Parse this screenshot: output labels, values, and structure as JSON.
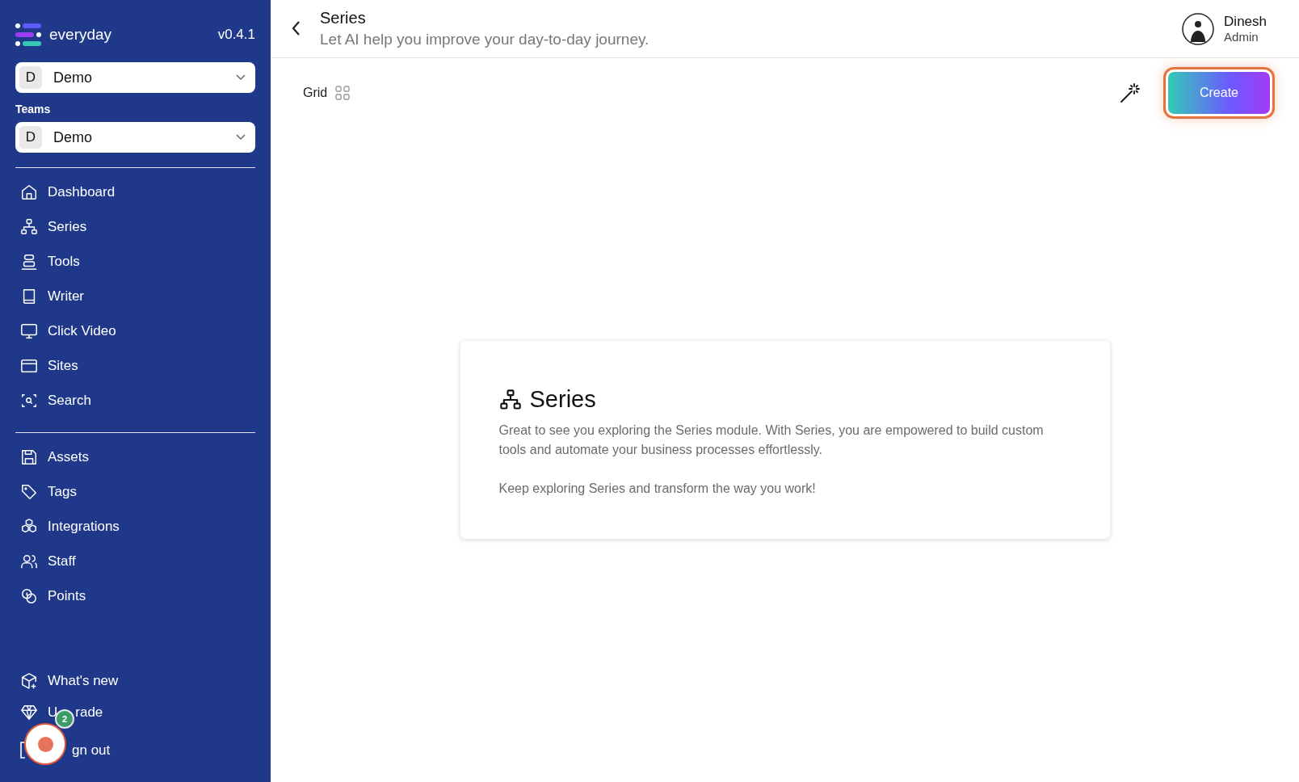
{
  "brand": {
    "name": "everyday",
    "version": "v0.4.1"
  },
  "workspace_select": {
    "initial": "D",
    "value": "Demo"
  },
  "teams": {
    "label": "Teams",
    "select": {
      "initial": "D",
      "value": "Demo"
    }
  },
  "nav_main": [
    {
      "label": "Dashboard",
      "selected": false
    },
    {
      "label": "Series",
      "selected": false
    },
    {
      "label": "Tools",
      "selected": false
    },
    {
      "label": "Writer",
      "selected": false
    },
    {
      "label": "Click Video",
      "selected": false
    },
    {
      "label": "Sites",
      "selected": false
    },
    {
      "label": "Search",
      "selected": false
    }
  ],
  "nav_secondary": [
    {
      "label": "Assets",
      "selected": false
    },
    {
      "label": "Tags",
      "selected": false
    },
    {
      "label": "Integrations",
      "selected": false
    },
    {
      "label": "Staff",
      "selected": false
    },
    {
      "label": "Points",
      "selected": false
    }
  ],
  "nav_bottom": [
    {
      "label_parts": [
        "What's new"
      ]
    },
    {
      "label_parts": [
        "U",
        "rade"
      ]
    },
    {
      "label_parts": [
        "gn out"
      ]
    }
  ],
  "record_button": {
    "badge": "2"
  },
  "header": {
    "title": "Series",
    "subtitle": "Let AI help you improve your day-to-day journey."
  },
  "user": {
    "name": "Dinesh",
    "role": "Admin"
  },
  "toolbar": {
    "view_label": "Grid",
    "create_button": "Create"
  },
  "card": {
    "title": "Series",
    "paragraphs": [
      "Great to see you exploring the Series module. With Series, you are empowered to build custom tools and automate your business processes effortlessly.",
      "Keep exploring Series and transform the way you work!"
    ]
  }
}
